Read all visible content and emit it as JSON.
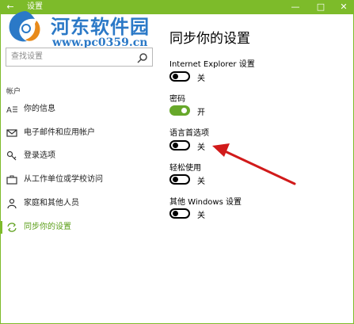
{
  "window": {
    "title": "设置",
    "accent": "#7dbb2a",
    "controls": [
      "back-icon",
      "minimize-icon",
      "maximize-icon",
      "close-icon"
    ]
  },
  "watermark": {
    "title": "河东软件园",
    "url": "www.pc0359.cn"
  },
  "sidebar": {
    "search_placeholder": "查找设置",
    "section": "帐户",
    "items": [
      {
        "label": "你的信息",
        "icon": "contact-card-icon",
        "active": false
      },
      {
        "label": "电子邮件和应用帐户",
        "icon": "mail-icon",
        "active": false
      },
      {
        "label": "登录选项",
        "icon": "key-icon",
        "active": false
      },
      {
        "label": "从工作单位或学校访问",
        "icon": "briefcase-icon",
        "active": false
      },
      {
        "label": "家庭和其他人员",
        "icon": "person-icon",
        "active": false
      },
      {
        "label": "同步你的设置",
        "icon": "sync-icon",
        "active": true
      }
    ]
  },
  "main": {
    "heading": "同步你的设置",
    "settings": [
      {
        "label": "Internet Explorer 设置",
        "state": "关",
        "on": false
      },
      {
        "label": "密码",
        "state": "开",
        "on": true
      },
      {
        "label": "语言首选项",
        "state": "关",
        "on": false
      },
      {
        "label": "轻松使用",
        "state": "关",
        "on": false
      },
      {
        "label": "其他 Windows 设置",
        "state": "关",
        "on": false
      }
    ]
  },
  "annotation": {
    "color": "#d11a1a",
    "icon": "red-arrow-icon"
  }
}
